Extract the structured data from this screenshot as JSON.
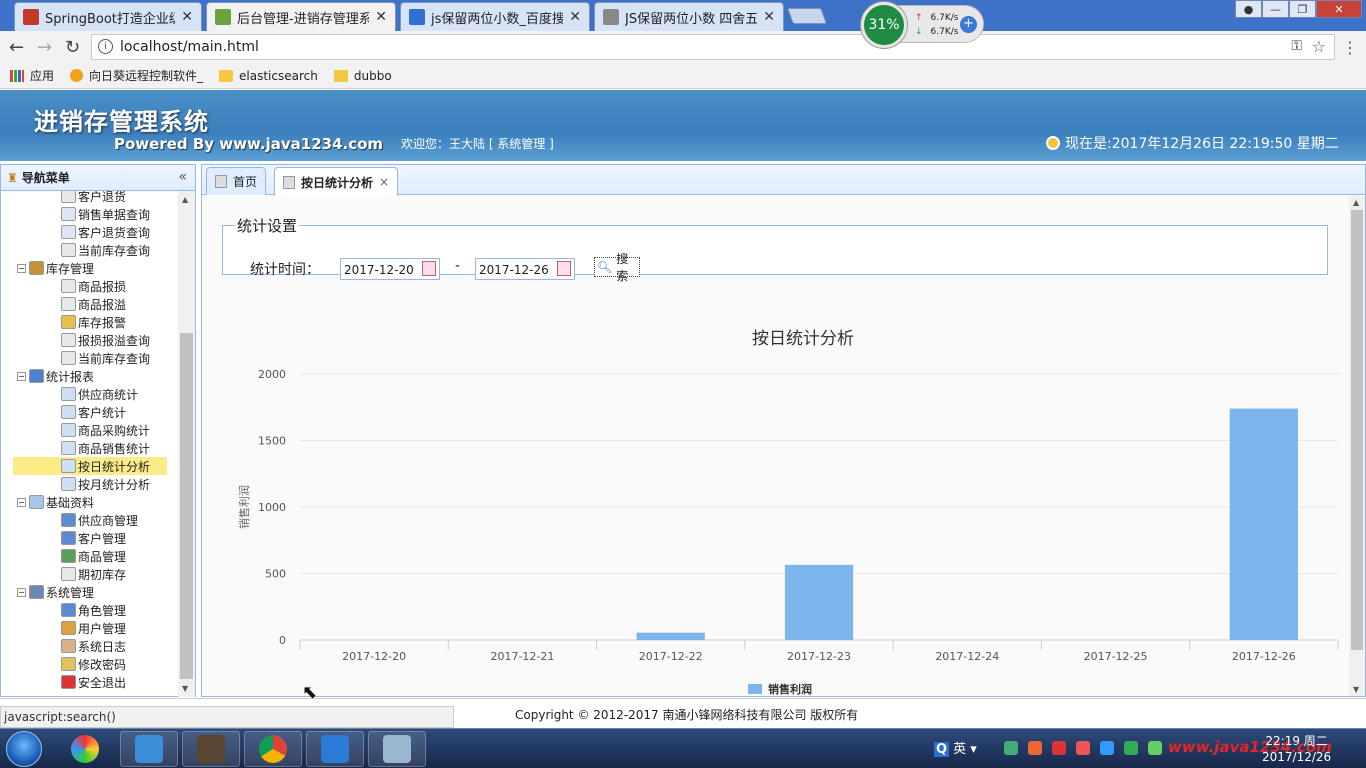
{
  "browser": {
    "tabs": [
      {
        "title": "SpringBoot打造企业级进",
        "favicon_color": "#c0392b"
      },
      {
        "title": "后台管理-进销存管理系统",
        "favicon_color": "#6aa33a"
      },
      {
        "title": "js保留两位小数_百度搜索",
        "favicon_color": "#2f6fd6"
      },
      {
        "title": "JS保留两位小数 四舍五入",
        "favicon_color": "#888888"
      }
    ],
    "address": "localhost/main.html",
    "bookmarks": [
      {
        "label": "应用",
        "icon": "apps-grid-icon"
      },
      {
        "label": "向日葵远程控制软件_",
        "icon": "sunflower-icon"
      },
      {
        "label": "elasticsearch",
        "icon": "folder-icon"
      },
      {
        "label": "dubbo",
        "icon": "folder-icon"
      }
    ]
  },
  "speed_widget": {
    "percent": "31%",
    "up": "6.7K/s",
    "down": "6.7K/s"
  },
  "header": {
    "title": "进销存管理系统",
    "powered": "Powered By www.java1234.com",
    "welcome": "欢迎您：王大陆 [ 系统管理 ]",
    "datetime": "现在是:2017年12月26日 22:19:50 星期二"
  },
  "sidebar": {
    "title": "导航菜单",
    "items": [
      {
        "label": "客户退货",
        "level": 2,
        "icon": "doc-icon"
      },
      {
        "label": "销售单据查询",
        "level": 2,
        "icon": "search-doc-icon"
      },
      {
        "label": "客户退货查询",
        "level": 2,
        "icon": "search-doc-icon"
      },
      {
        "label": "当前库存查询",
        "level": 2,
        "icon": "doc-icon"
      },
      {
        "label": "库存管理",
        "level": 1,
        "icon": "box-icon"
      },
      {
        "label": "商品报损",
        "level": 2,
        "icon": "doc-icon"
      },
      {
        "label": "商品报溢",
        "level": 2,
        "icon": "doc-icon"
      },
      {
        "label": "库存报警",
        "level": 2,
        "icon": "alarm-icon"
      },
      {
        "label": "报损报溢查询",
        "level": 2,
        "icon": "doc-icon"
      },
      {
        "label": "当前库存查询",
        "level": 2,
        "icon": "doc-icon"
      },
      {
        "label": "统计报表",
        "level": 1,
        "icon": "bar-chart-icon"
      },
      {
        "label": "供应商统计",
        "level": 2,
        "icon": "chart-doc-icon"
      },
      {
        "label": "客户统计",
        "level": 2,
        "icon": "chart-doc-icon"
      },
      {
        "label": "商品采购统计",
        "level": 2,
        "icon": "chart-doc-icon"
      },
      {
        "label": "商品销售统计",
        "level": 2,
        "icon": "chart-doc-icon"
      },
      {
        "label": "按日统计分析",
        "level": 2,
        "icon": "chart-doc-icon",
        "selected": true
      },
      {
        "label": "按月统计分析",
        "level": 2,
        "icon": "chart-doc-icon"
      },
      {
        "label": "基础资料",
        "level": 1,
        "icon": "base-data-icon"
      },
      {
        "label": "供应商管理",
        "level": 2,
        "icon": "user-icon"
      },
      {
        "label": "客户管理",
        "level": 2,
        "icon": "user-icon"
      },
      {
        "label": "商品管理",
        "level": 2,
        "icon": "tree-icon"
      },
      {
        "label": "期初库存",
        "level": 2,
        "icon": "doc-icon"
      },
      {
        "label": "系统管理",
        "level": 1,
        "icon": "computer-icon"
      },
      {
        "label": "角色管理",
        "level": 2,
        "icon": "user-icon"
      },
      {
        "label": "用户管理",
        "level": 2,
        "icon": "users-icon"
      },
      {
        "label": "系统日志",
        "level": 2,
        "icon": "log-icon"
      },
      {
        "label": "修改密码",
        "level": 2,
        "icon": "key-icon"
      },
      {
        "label": "安全退出",
        "level": 2,
        "icon": "exit-icon"
      }
    ]
  },
  "tabs": [
    {
      "label": "首页"
    },
    {
      "label": "按日统计分析",
      "close": "×"
    }
  ],
  "filter": {
    "legend": "统计设置",
    "time_label": "统计时间：",
    "start": "2017-12-20",
    "separator": "-",
    "end": "2017-12-26",
    "search_label": "搜索"
  },
  "chart_data": {
    "type": "bar",
    "title": "按日统计分析",
    "ylabel": "销售利润",
    "xlabel": "",
    "categories": [
      "2017-12-20",
      "2017-12-21",
      "2017-12-22",
      "2017-12-23",
      "2017-12-24",
      "2017-12-25",
      "2017-12-26"
    ],
    "series": [
      {
        "name": "销售利润",
        "values": [
          0,
          0,
          55,
          565,
          0,
          0,
          1740
        ],
        "color": "#7cb5ec"
      }
    ],
    "ylim": [
      0,
      2000
    ],
    "yticks": [
      0,
      500,
      1000,
      1500,
      2000
    ],
    "grid": true,
    "legend": "bottom"
  },
  "footer": {
    "copyright": "Copyright © 2012-2017 南通小锋网络科技有限公司 版权所有"
  },
  "status_url": "javascript:search()",
  "taskbar": {
    "ime": "英",
    "time": "22:19 周二",
    "date": "2017/12/26",
    "watermark": "www.java1234.com"
  }
}
